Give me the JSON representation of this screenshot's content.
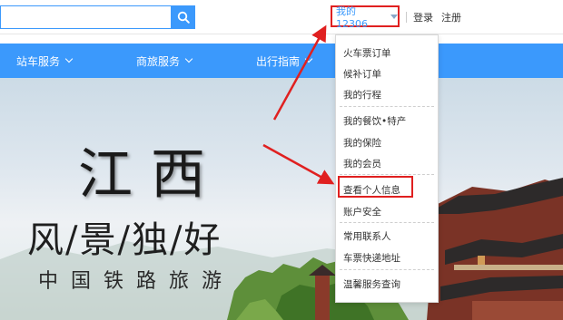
{
  "topbar": {
    "search_placeholder": "",
    "my12306_label": "我的12306",
    "login_label": "登录",
    "register_label": "注册"
  },
  "nav": {
    "items": [
      {
        "label": "站车服务"
      },
      {
        "label": "商旅服务"
      },
      {
        "label": "出行指南"
      }
    ]
  },
  "hero": {
    "title": "江西",
    "subtitle": "风/景/独/好",
    "tagline": "中国铁路旅游"
  },
  "dropdown": {
    "items": [
      {
        "label": "火车票订单"
      },
      {
        "label": "候补订单"
      },
      {
        "label": "我的行程"
      },
      {
        "label": "我的餐饮•特产"
      },
      {
        "label": "我的保险"
      },
      {
        "label": "我的会员"
      },
      {
        "label": "查看个人信息"
      },
      {
        "label": "账户安全"
      },
      {
        "label": "常用联系人"
      },
      {
        "label": "车票快递地址"
      },
      {
        "label": "温馨服务查询"
      }
    ]
  },
  "colors": {
    "brand_blue": "#3b99fc",
    "annotation_red": "#e02020"
  },
  "icons": {
    "search": "search-icon",
    "caret": "caret-down-icon",
    "chevron": "chevron-down-icon"
  }
}
